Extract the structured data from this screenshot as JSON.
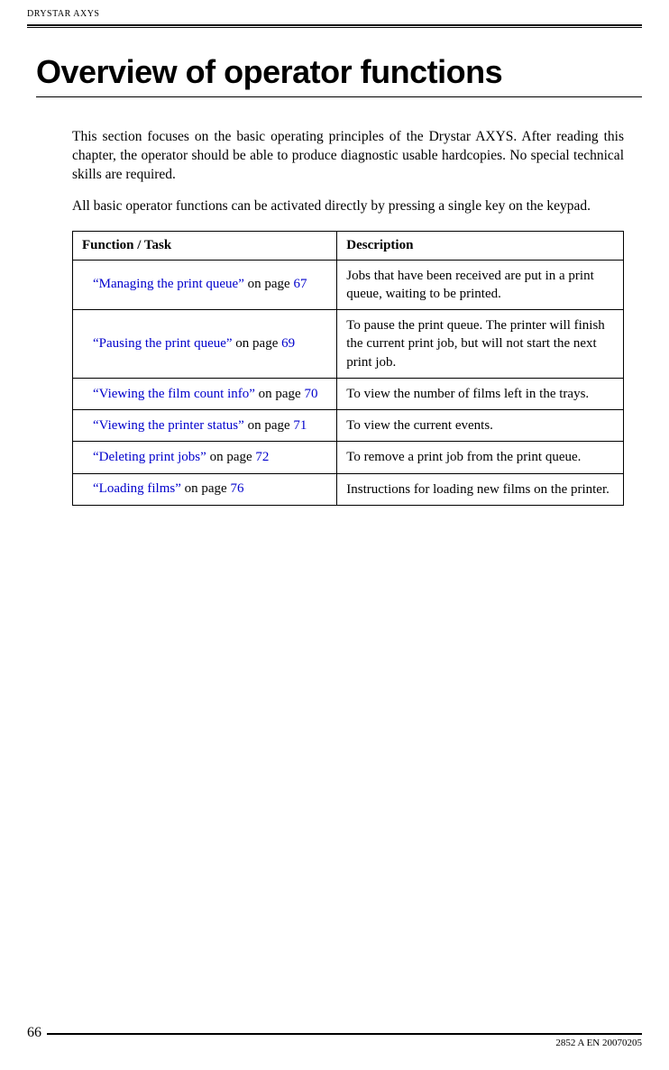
{
  "header": {
    "product_label": "DRYSTAR AXYS"
  },
  "title": "Overview of operator functions",
  "paragraphs": {
    "p1": "This section focuses on the basic operating principles of the Drystar AXYS. After reading this chapter, the operator should be able to produce diagnostic usable hardcopies. No special technical skills are required.",
    "p2": "All basic operator functions can be activated directly by pressing a single key on the keypad."
  },
  "table": {
    "headers": {
      "function": "Function / Task",
      "description": "Description"
    },
    "rows": [
      {
        "link_text": "“Managing the print queue”",
        "on_page": " on page ",
        "page_num": "67",
        "description": "Jobs that have been received are put in a print queue, waiting to be printed."
      },
      {
        "link_text": "“Pausing the print queue”",
        "on_page": " on page ",
        "page_num": "69",
        "description": "To pause the print queue. The printer will finish the current print job, but will not start the next print job."
      },
      {
        "link_text": "“Viewing the film count info”",
        "on_page": " on page ",
        "page_num": "70",
        "description": "To view the number of films left in the trays."
      },
      {
        "link_text": "“Viewing the printer status”",
        "on_page": " on page ",
        "page_num": "71",
        "description": "To view the current events."
      },
      {
        "link_text": "“Deleting print jobs”",
        "on_page": " on page ",
        "page_num": "72",
        "description": "To remove a print job from the print queue."
      },
      {
        "link_text": "“Loading films”",
        "on_page": " on page ",
        "page_num": "76",
        "description": "Instructions for loading new films on the printer."
      }
    ]
  },
  "footer": {
    "page_number": "66",
    "doc_id": "2852 A EN 20070205"
  }
}
